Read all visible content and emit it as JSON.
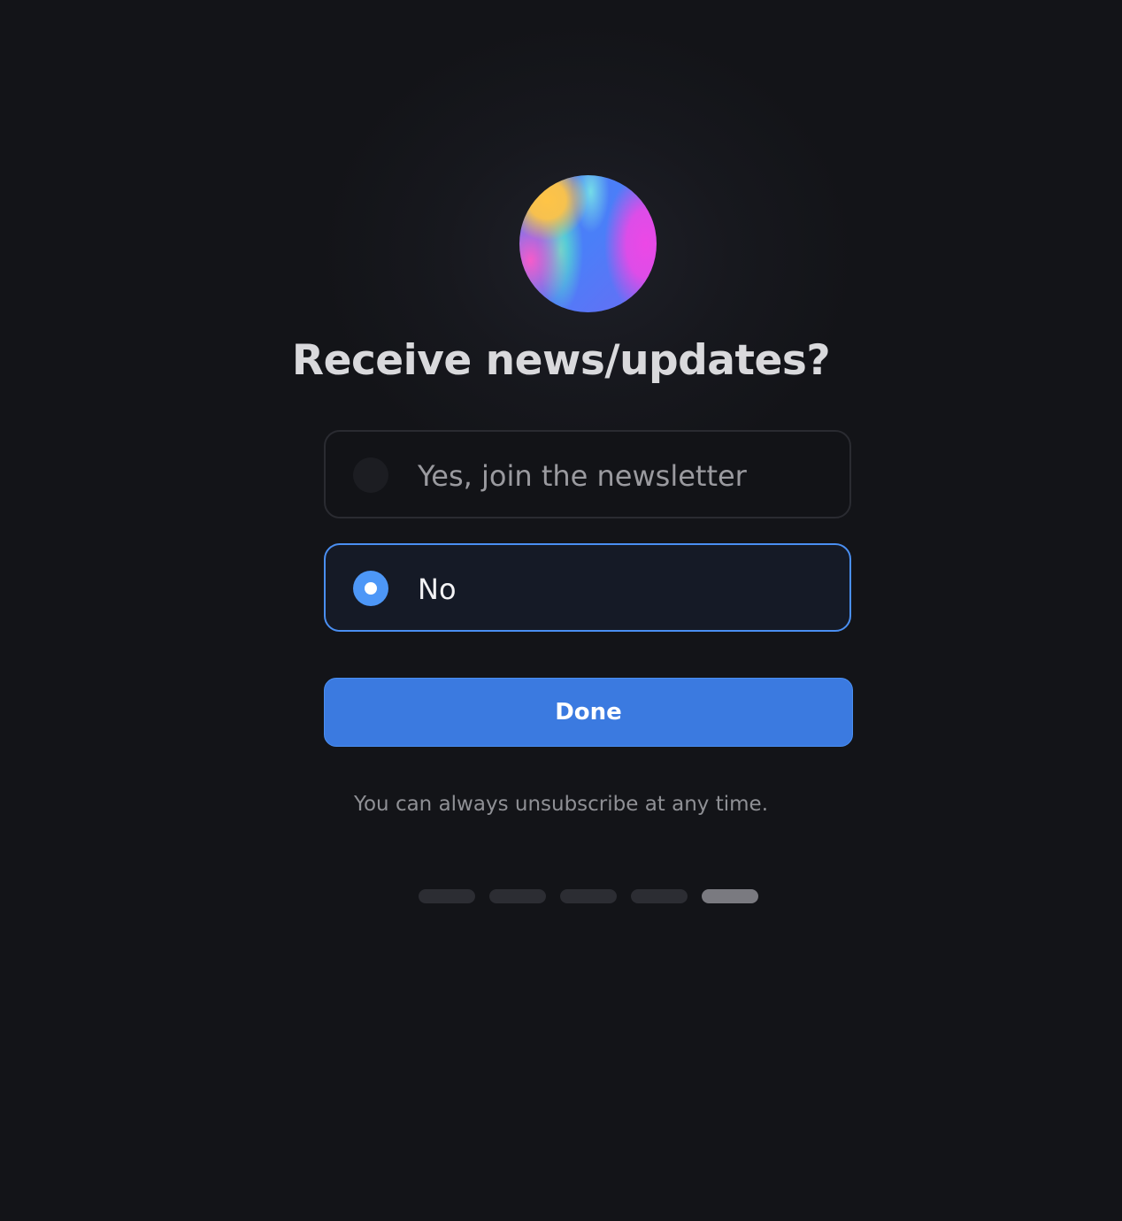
{
  "dialog": {
    "title": "Receive news/updates?",
    "options": [
      {
        "label": "Yes, join the newsletter",
        "selected": false
      },
      {
        "label": "No",
        "selected": true
      }
    ],
    "done_label": "Done",
    "note": "You can always unsubscribe at any time."
  },
  "pager": {
    "total_steps": 5,
    "current_step": 5
  },
  "colors": {
    "background": "#131418",
    "accent": "#3b7ae0",
    "selected_border": "#4a8ff2",
    "radio_selected": "#4d97f7"
  },
  "icons": {
    "logo": "gradient-orb-logo"
  }
}
